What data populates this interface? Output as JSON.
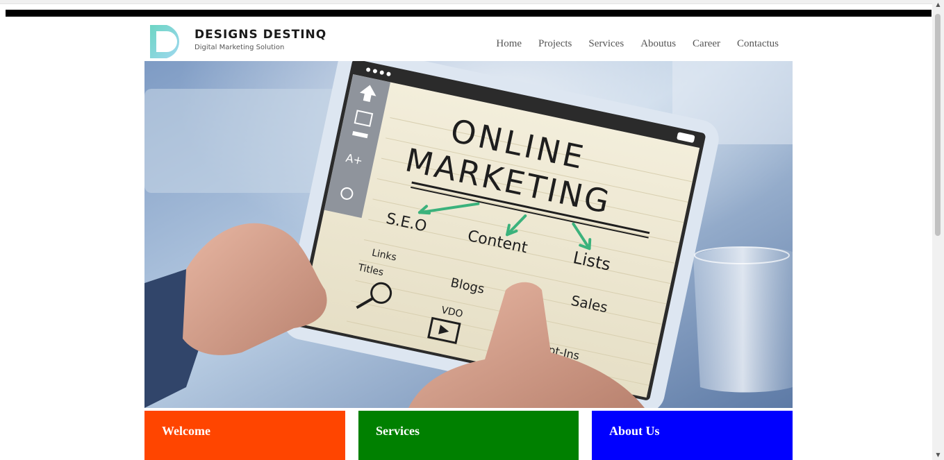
{
  "logo": {
    "title": "DESIGNS DESTINQ",
    "subtitle": "Digital Marketing Solution"
  },
  "nav": [
    "Home",
    "Projects",
    "Services",
    "Aboutus",
    "Career",
    "Contactus"
  ],
  "hero": {
    "image_text": {
      "headline_1": "ONLINE",
      "headline_2": "MARKETING",
      "seo": "S.E.O",
      "content": "Content",
      "lists": "Lists",
      "links": "Links",
      "titles": "Titles",
      "blogs": "Blogs",
      "video": "VDO",
      "sales": "Sales",
      "optin": "Opt-Ins"
    }
  },
  "panels": [
    {
      "title": "Welcome",
      "color": "#ff4500"
    },
    {
      "title": "Services",
      "color": "#008000"
    },
    {
      "title": "About Us",
      "color": "#0000ff"
    }
  ]
}
